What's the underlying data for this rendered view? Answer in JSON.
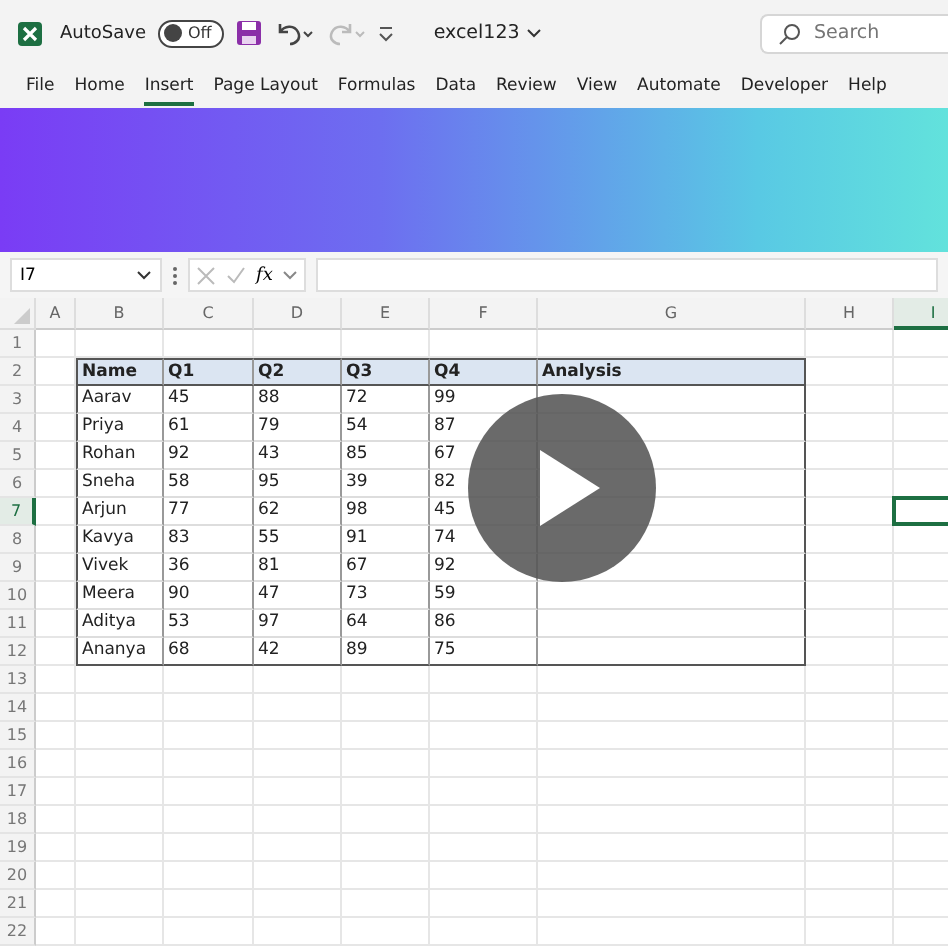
{
  "title_bar": {
    "autosave_label": "AutoSave",
    "autosave_toggle": {
      "label": "Off",
      "on": false
    },
    "file_name": "excel123",
    "search": {
      "placeholder": "Search"
    }
  },
  "menu": [
    {
      "label": "File",
      "selected": false
    },
    {
      "label": "Home",
      "selected": false
    },
    {
      "label": "Insert",
      "selected": true
    },
    {
      "label": "Page Layout",
      "selected": false
    },
    {
      "label": "Formulas",
      "selected": false
    },
    {
      "label": "Data",
      "selected": false
    },
    {
      "label": "Review",
      "selected": false
    },
    {
      "label": "View",
      "selected": false
    },
    {
      "label": "Automate",
      "selected": false
    },
    {
      "label": "Developer",
      "selected": false
    },
    {
      "label": "Help",
      "selected": false
    }
  ],
  "formula_bar": {
    "name_box": "I7",
    "function_label": "fx"
  },
  "columns": [
    {
      "label": "A",
      "selected": false
    },
    {
      "label": "B",
      "selected": false
    },
    {
      "label": "C",
      "selected": false
    },
    {
      "label": "D",
      "selected": false
    },
    {
      "label": "E",
      "selected": false
    },
    {
      "label": "F",
      "selected": false
    },
    {
      "label": "G",
      "selected": false
    },
    {
      "label": "H",
      "selected": false
    },
    {
      "label": "I",
      "selected": true
    }
  ],
  "rows": [
    {
      "label": "1",
      "selected": false
    },
    {
      "label": "2",
      "selected": false
    },
    {
      "label": "3",
      "selected": false
    },
    {
      "label": "4",
      "selected": false
    },
    {
      "label": "5",
      "selected": false
    },
    {
      "label": "6",
      "selected": false
    },
    {
      "label": "7",
      "selected": true
    },
    {
      "label": "8",
      "selected": false
    },
    {
      "label": "9",
      "selected": false
    },
    {
      "label": "10",
      "selected": false
    },
    {
      "label": "11",
      "selected": false
    },
    {
      "label": "12",
      "selected": false
    },
    {
      "label": "13",
      "selected": false
    },
    {
      "label": "14",
      "selected": false
    },
    {
      "label": "15",
      "selected": false
    },
    {
      "label": "16",
      "selected": false
    },
    {
      "label": "17",
      "selected": false
    },
    {
      "label": "18",
      "selected": false
    },
    {
      "label": "19",
      "selected": false
    },
    {
      "label": "20",
      "selected": false
    },
    {
      "label": "21",
      "selected": false
    },
    {
      "label": "22",
      "selected": false
    }
  ],
  "table": {
    "columns": [
      "Name",
      "Q1",
      "Q2",
      "Q3",
      "Q4",
      "Analysis"
    ],
    "rows": [
      [
        "Aarav",
        "45",
        "88",
        "72",
        "99"
      ],
      [
        "Priya",
        "61",
        "79",
        "54",
        "87"
      ],
      [
        "Rohan",
        "92",
        "43",
        "85",
        "67"
      ],
      [
        "Sneha",
        "58",
        "95",
        "39",
        "82"
      ],
      [
        "Arjun",
        "77",
        "62",
        "98",
        "45"
      ],
      [
        "Kavya",
        "83",
        "55",
        "91",
        "74"
      ],
      [
        "Vivek",
        "36",
        "81",
        "67",
        "92"
      ],
      [
        "Meera",
        "90",
        "47",
        "73",
        "59"
      ],
      [
        "Aditya",
        "53",
        "97",
        "64",
        "86"
      ],
      [
        "Ananya",
        "68",
        "42",
        "89",
        "75"
      ]
    ]
  }
}
